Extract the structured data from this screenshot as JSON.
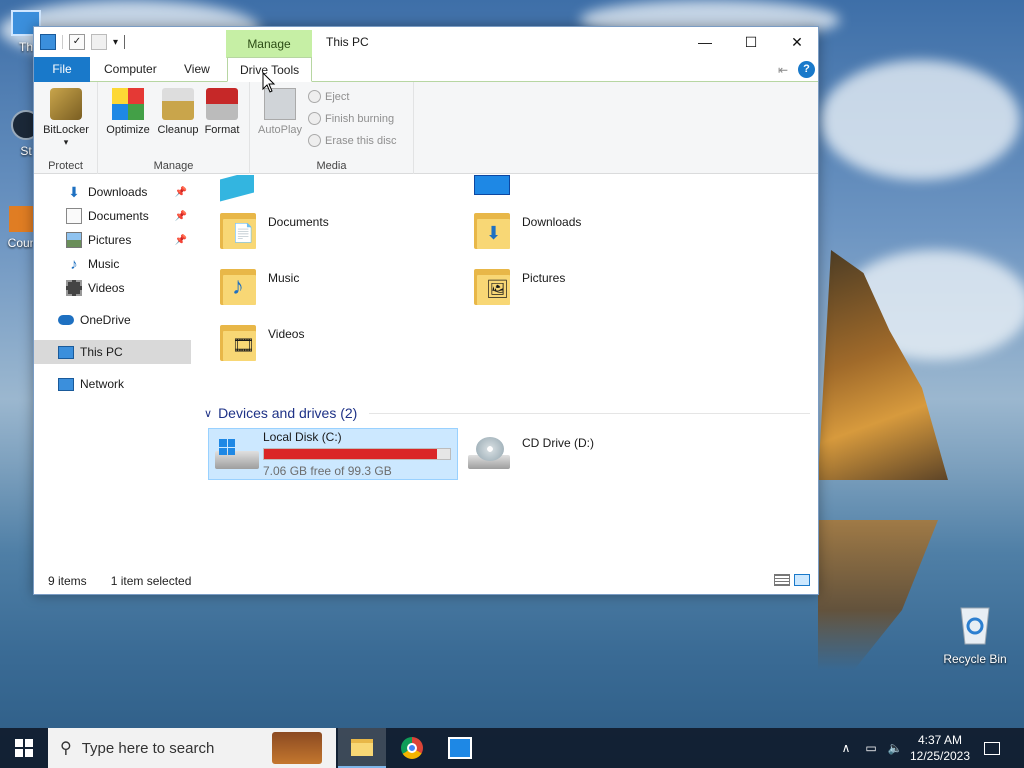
{
  "desktop": {
    "icons": [
      {
        "label": "Th",
        "name": "this-pc-desktop-icon"
      },
      {
        "label": "St",
        "name": "steam-desktop-icon"
      },
      {
        "label": "Coun",
        "name": "counter-desktop-icon"
      },
      {
        "label": "Recycle Bin",
        "name": "recycle-bin-icon"
      }
    ]
  },
  "window": {
    "title": "This PC",
    "context_tab": "Manage",
    "tabs": [
      "File",
      "Computer",
      "View",
      "Drive Tools"
    ],
    "ribbon": {
      "groups": [
        {
          "label": "Protect",
          "buttons": [
            "BitLocker"
          ]
        },
        {
          "label": "Manage",
          "buttons": [
            "Optimize",
            "Cleanup",
            "Format"
          ]
        },
        {
          "label": "Media",
          "buttons": [
            "AutoPlay"
          ],
          "small_buttons": [
            "Eject",
            "Finish burning",
            "Erase this disc"
          ]
        }
      ]
    },
    "nav": {
      "items": [
        {
          "label": "Downloads",
          "pinned": true,
          "icon": "download-icon"
        },
        {
          "label": "Documents",
          "pinned": true,
          "icon": "document-icon"
        },
        {
          "label": "Pictures",
          "pinned": true,
          "icon": "picture-icon"
        },
        {
          "label": "Music",
          "pinned": false,
          "icon": "music-icon"
        },
        {
          "label": "Videos",
          "pinned": false,
          "icon": "video-icon"
        },
        {
          "label": "OneDrive",
          "pinned": false,
          "icon": "cloud-icon"
        },
        {
          "label": "This PC",
          "pinned": false,
          "icon": "computer-icon"
        },
        {
          "label": "Network",
          "pinned": false,
          "icon": "network-icon"
        }
      ]
    },
    "folders": [
      {
        "label": "Documents",
        "glyph": "📄"
      },
      {
        "label": "Downloads",
        "glyph": "⬇"
      },
      {
        "label": "Music",
        "glyph": "♪"
      },
      {
        "label": "Pictures",
        "glyph": "🖼"
      },
      {
        "label": "Videos",
        "glyph": "🎞"
      }
    ],
    "section_title": "Devices and drives (2)",
    "drives": [
      {
        "label": "Local Disk (C:)",
        "free_text": "7.06 GB free of 99.3 GB",
        "used_fraction": 0.929
      },
      {
        "label": "CD Drive (D:)"
      }
    ],
    "status": {
      "items": "9 items",
      "selected": "1 item selected"
    }
  },
  "taskbar": {
    "search_placeholder": "Type here to search",
    "time": "4:37 AM",
    "date": "12/25/2023"
  },
  "colors": {
    "accent": "#1979ca",
    "context_tab": "#c6efa5",
    "drive_bar": "#da2626"
  }
}
